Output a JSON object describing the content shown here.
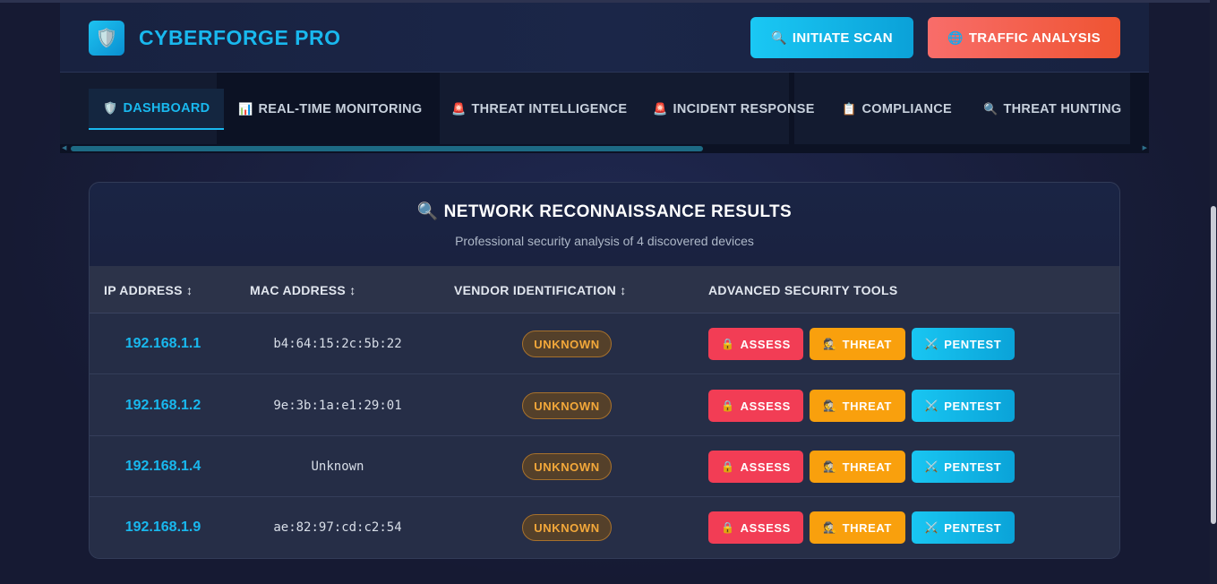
{
  "app": {
    "title": "CYBERFORGE PRO",
    "logo_icon": "🛡️"
  },
  "header": {
    "scan_button": {
      "icon": "🔍",
      "label": "INITIATE SCAN"
    },
    "traffic_button": {
      "icon": "🌐",
      "label": "TRAFFIC ANALYSIS"
    }
  },
  "tabs": [
    {
      "icon": "🛡️",
      "label": "DASHBOARD",
      "active": true
    },
    {
      "icon": "📊",
      "label": "REAL-TIME MONITORING"
    },
    {
      "icon": "🚨",
      "label": "THREAT INTELLIGENCE"
    },
    {
      "icon": "🚨",
      "label": "INCIDENT RESPONSE"
    },
    {
      "icon": "📋",
      "label": "COMPLIANCE"
    },
    {
      "icon": "🔍",
      "label": "THREAT HUNTING"
    }
  ],
  "results": {
    "title_icon": "🔍",
    "title": "NETWORK RECONNAISSANCE RESULTS",
    "subtitle": "Professional security analysis of 4 discovered devices",
    "columns": {
      "ip": "IP ADDRESS ↕",
      "mac": "MAC ADDRESS ↕",
      "vendor": "VENDOR IDENTIFICATION ↕",
      "tools": "ADVANCED SECURITY TOOLS"
    },
    "actions": {
      "assess": {
        "icon": "🔒",
        "label": "ASSESS"
      },
      "threat": {
        "icon": "🕵",
        "label": "THREAT"
      },
      "pentest": {
        "icon": "⚔️",
        "label": "PENTEST"
      }
    },
    "rows": [
      {
        "ip": "192.168.1.1",
        "mac": "b4:64:15:2c:5b:22",
        "vendor": "UNKNOWN"
      },
      {
        "ip": "192.168.1.2",
        "mac": "9e:3b:1a:e1:29:01",
        "vendor": "UNKNOWN"
      },
      {
        "ip": "192.168.1.4",
        "mac": "Unknown",
        "vendor": "UNKNOWN"
      },
      {
        "ip": "192.168.1.9",
        "mac": "ae:82:97:cd:c2:54",
        "vendor": "UNKNOWN"
      }
    ]
  },
  "colors": {
    "accent": "#19b8ee",
    "assess": "#f23d55",
    "threat": "#f9a00d",
    "pentest": "#19c6f2",
    "vendor_badge": "#f3a83a"
  }
}
